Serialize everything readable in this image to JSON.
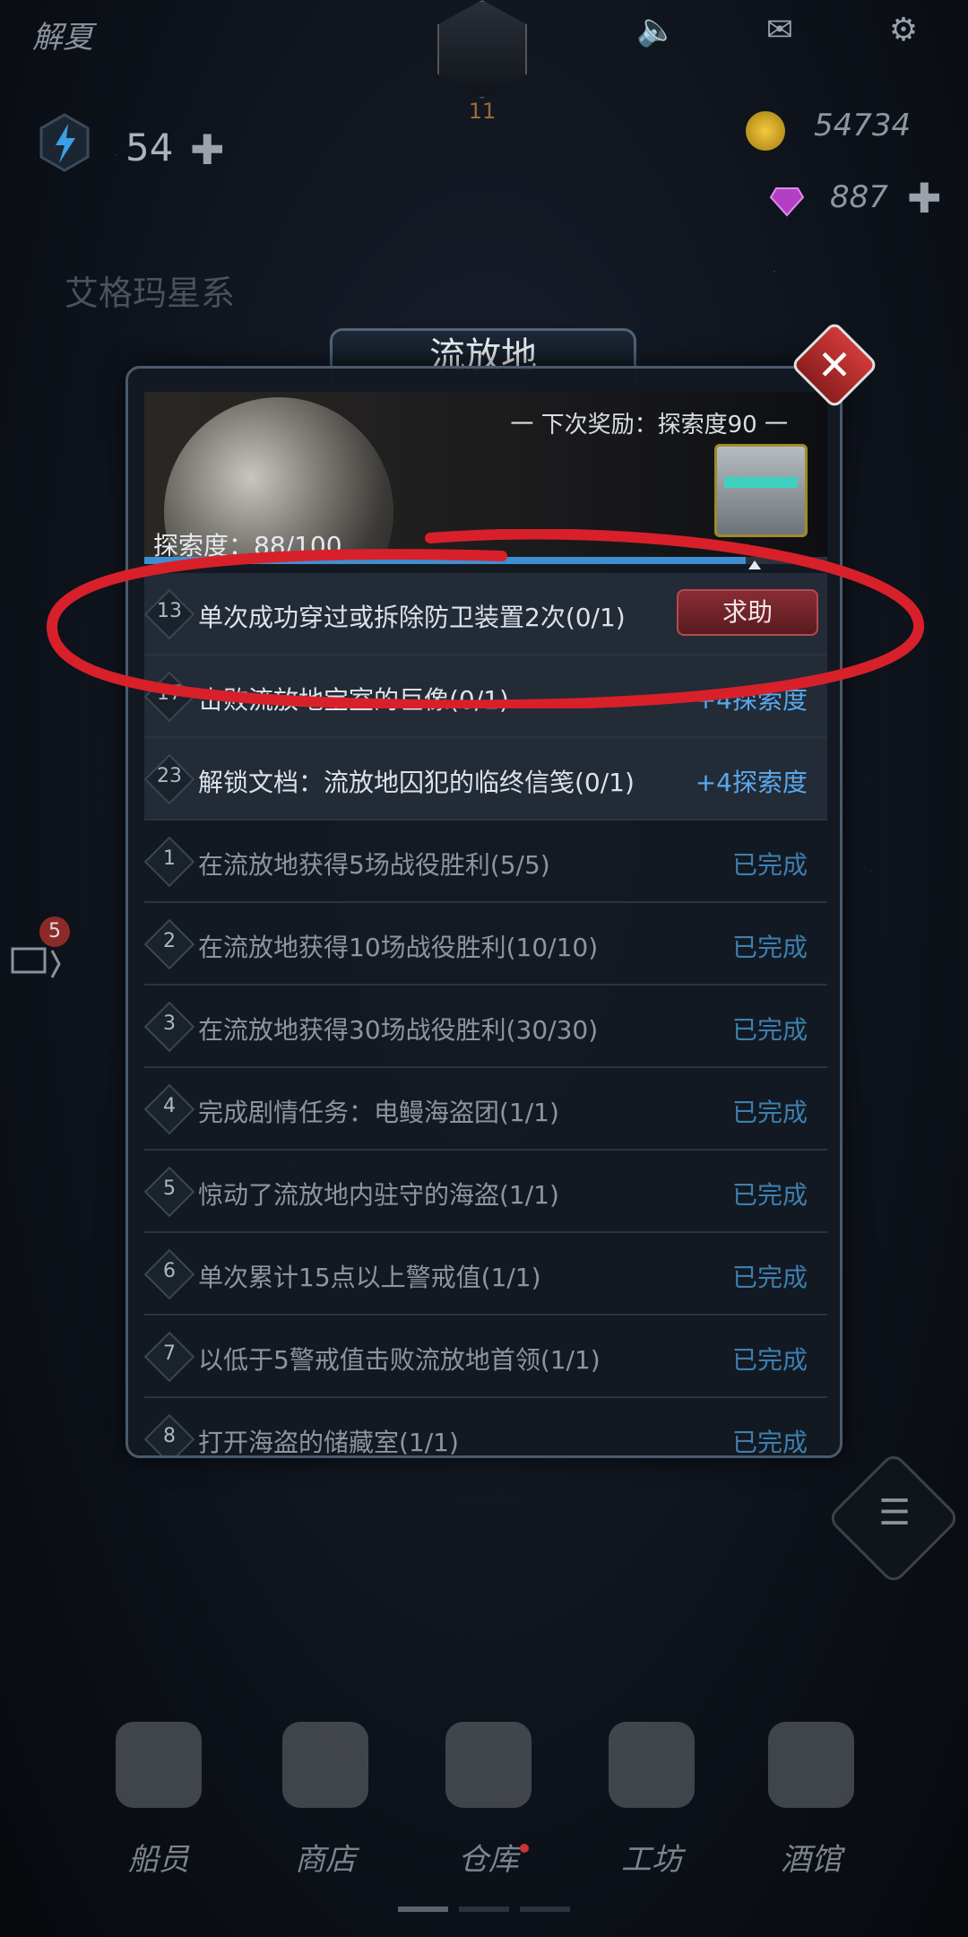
{
  "top_bar": {
    "player_name": "解夏",
    "avatar_level": "11",
    "energy": "54",
    "coins": "54734",
    "gems": "887",
    "system_name": "艾格玛星系"
  },
  "side": {
    "chat_badge": "5"
  },
  "dialog": {
    "title": "流放地",
    "next_reward": "一  下次奖励：探索度90  一",
    "explore_label": "探索度：88/100",
    "progress_fraction": 0.88,
    "help_label": "求助",
    "tasks": [
      {
        "num": "13",
        "text": "单次成功穿过或拆除防卫装置2次(0/1)",
        "status": ""
      },
      {
        "num": "17",
        "text": "击败流放地宝室的巨像(0/1)",
        "status": "+4探索度"
      },
      {
        "num": "23",
        "text": "解锁文档：流放地囚犯的临终信笺(0/1)",
        "status": "+4探索度"
      },
      {
        "num": "1",
        "text": "在流放地获得5场战役胜利(5/5)",
        "status": "已完成"
      },
      {
        "num": "2",
        "text": "在流放地获得10场战役胜利(10/10)",
        "status": "已完成"
      },
      {
        "num": "3",
        "text": "在流放地获得30场战役胜利(30/30)",
        "status": "已完成"
      },
      {
        "num": "4",
        "text": "完成剧情任务：电鳗海盗团(1/1)",
        "status": "已完成"
      },
      {
        "num": "5",
        "text": "惊动了流放地内驻守的海盗(1/1)",
        "status": "已完成"
      },
      {
        "num": "6",
        "text": "单次累计15点以上警戒值(1/1)",
        "status": "已完成"
      },
      {
        "num": "7",
        "text": "以低于5警戒值击败流放地首领(1/1)",
        "status": "已完成"
      },
      {
        "num": "8",
        "text": "打开海盗的储藏室(1/1)",
        "status": "已完成"
      }
    ]
  },
  "nav": {
    "crew": "船员",
    "shop": "商店",
    "warehouse": "仓库",
    "workshop": "工坊",
    "tavern": "酒馆"
  },
  "colors": {
    "accent": "#3f8fd0",
    "annotation": "#d8202a",
    "help_button": "#8a2c34"
  }
}
